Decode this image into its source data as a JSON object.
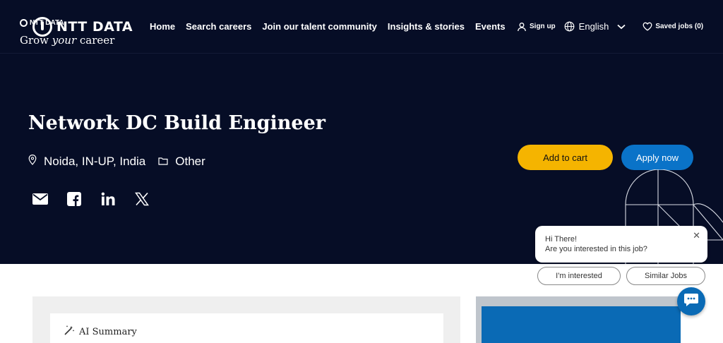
{
  "header": {
    "logo_text": "NTT DATA",
    "nav": [
      {
        "label": "Home"
      },
      {
        "label": "Search careers"
      },
      {
        "label": "Join our talent community"
      },
      {
        "label": "Insights & stories"
      },
      {
        "label": "Events"
      }
    ],
    "sign_up_label": "Sign up",
    "language_label": "English",
    "saved_jobs_label": "Saved jobs (0)"
  },
  "job": {
    "title": "Network DC Build Engineer",
    "location": "Noida, IN-UP, India",
    "category": "Other",
    "share_icons": [
      "email-icon",
      "facebook-icon",
      "linkedin-icon",
      "x-icon"
    ],
    "add_to_cart_label": "Add to cart",
    "apply_label": "Apply now"
  },
  "content": {
    "ai_summary_label": "AI Summary"
  },
  "promo": {
    "logo_text": "NTT DATA",
    "title_part1": "Grow ",
    "title_part2": "your",
    "title_part3": " career"
  },
  "chat": {
    "greeting": "Hi There!",
    "question": "Are you interested in this job?",
    "options": [
      "I'm interested",
      "Similar Jobs"
    ]
  },
  "colors": {
    "navy": "#060d26",
    "yellow": "#f5b400",
    "blue": "#0a73c8",
    "promo_blue": "#0a6ab5"
  }
}
